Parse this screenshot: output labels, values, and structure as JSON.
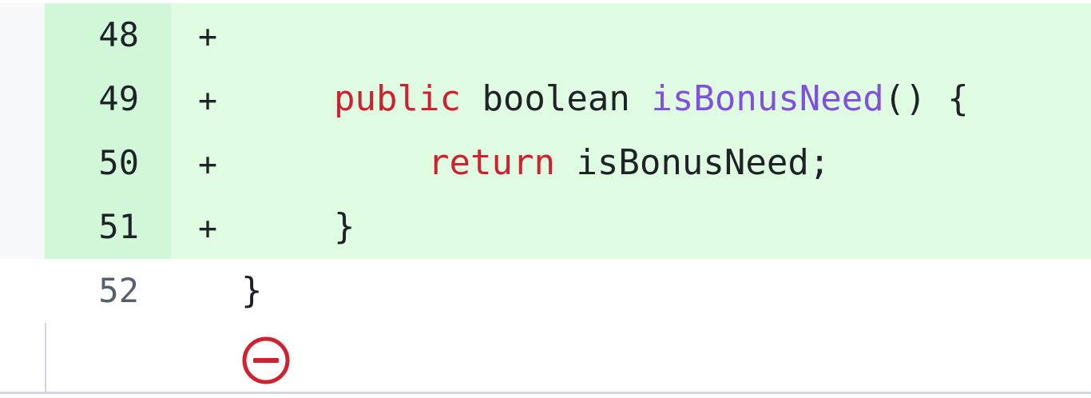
{
  "diff": {
    "lines": [
      {
        "number": "48",
        "marker": "+",
        "type": "added",
        "tokens": []
      },
      {
        "number": "49",
        "marker": "+",
        "type": "added",
        "tokens": [
          "public",
          " boolean ",
          "isBonusNeed",
          "() {"
        ]
      },
      {
        "number": "50",
        "marker": "+",
        "type": "added",
        "tokens": [
          "return",
          " isBonusNeed;"
        ]
      },
      {
        "number": "51",
        "marker": "+",
        "type": "added",
        "tokens": [
          "}"
        ]
      },
      {
        "number": "52",
        "marker": "",
        "type": "context",
        "tokens": [
          "}"
        ]
      }
    ],
    "collapse_icon": "minus-circle-icon"
  },
  "colors": {
    "added_bg": "#dffbe2",
    "added_gutter_bg": "#d1f7d8",
    "keyword": "#cf222e",
    "function_name": "#8250df",
    "text": "#1f2328",
    "collapse_icon": "#cf222e"
  }
}
